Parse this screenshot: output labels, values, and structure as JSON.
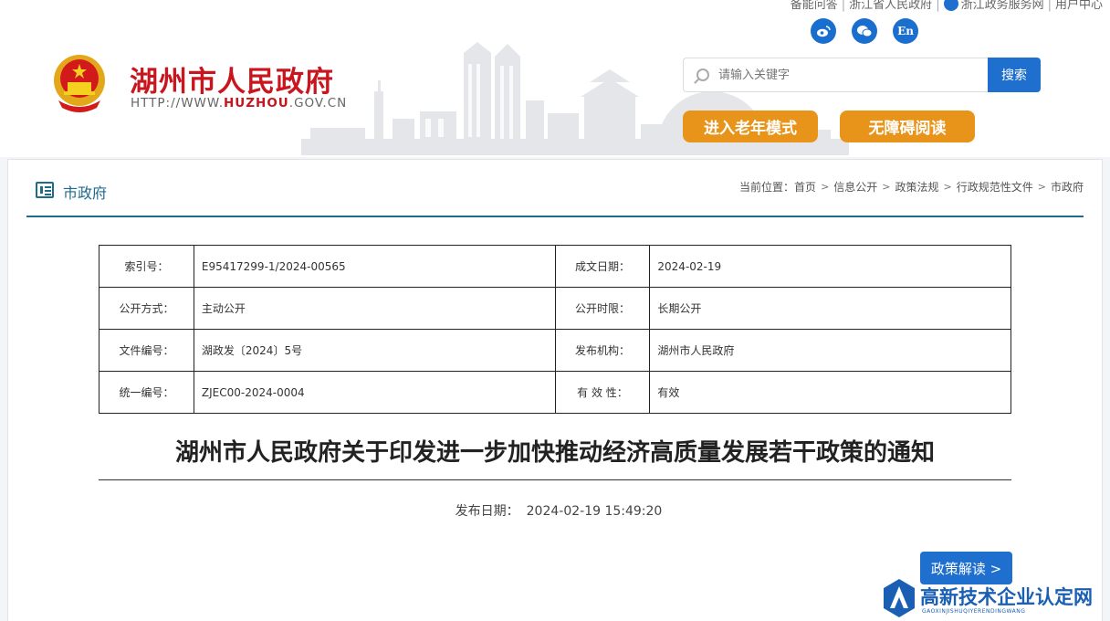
{
  "top_links": [
    "备能问答",
    "浙江省人民政府",
    "浙江政务服务网",
    "用户中心"
  ],
  "social": {
    "weibo": "weibo-icon",
    "wechat": "wechat-icon",
    "english": "En"
  },
  "site": {
    "title": "湖州市人民政府",
    "url_prefix": "HTTP://WWW.",
    "url_brand": "HUZHOU",
    "url_suffix": ".GOV.CN"
  },
  "search": {
    "placeholder": "请输入关键字",
    "button": "搜索"
  },
  "modes": {
    "elder": "进入老年模式",
    "accessible": "无障碍阅读"
  },
  "section": {
    "title": "市政府"
  },
  "breadcrumb": {
    "prefix": "当前位置：",
    "items": [
      "首页",
      "信息公开",
      "政策法规",
      "行政规范性文件",
      "市政府"
    ]
  },
  "info_table": [
    [
      "索引号：",
      "E95417299-1/2024-00565",
      "成文日期：",
      "2024-02-19"
    ],
    [
      "公开方式：",
      "主动公开",
      "公开时限：",
      "长期公开"
    ],
    [
      "文件编号：",
      "湖政发〔2024〕5号",
      "发布机构：",
      "湖州市人民政府"
    ],
    [
      "统一编号：",
      "ZJEC00-2024-0004",
      "有 效 性：",
      "有效"
    ]
  ],
  "document": {
    "title": "湖州市人民政府关于印发进一步加快推动经济高质量发展若干政策的通知",
    "date_label": "发布日期：",
    "date_value": "2024-02-19 15:49:20",
    "policy_button": "政策解读 >"
  },
  "watermark": {
    "text": "高新技术企业认定网",
    "sub": "GAOXINJISHUQIYERENDINGWANG"
  },
  "colors": {
    "brand_red": "#c9161e",
    "primary_blue": "#1f6fcf",
    "orange": "#e8941a",
    "teal": "#1f6b8c"
  }
}
